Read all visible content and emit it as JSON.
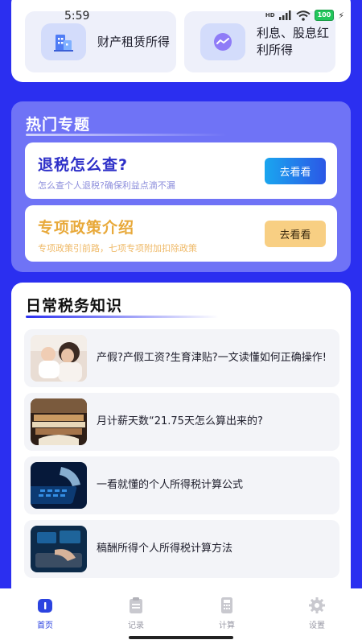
{
  "status_bar": {
    "time": "5:59",
    "battery": "100",
    "network": "HD"
  },
  "income_tiles": [
    {
      "label": "财产租赁所得",
      "icon": "building-icon"
    },
    {
      "label": "利息、股息红利所得",
      "icon": "chart-wave-icon"
    }
  ],
  "hot_topics": {
    "title": "热门专题",
    "items": [
      {
        "title": "退税怎么查?",
        "subtitle": "怎么查个人退税?确保利益点滴不漏",
        "button": "去看看",
        "color": "#2d2fc8"
      },
      {
        "title": "专项政策介绍",
        "subtitle": "专项政策引前路，七项专项附加扣除政策",
        "button": "去看看",
        "color": "#e8a93a"
      }
    ]
  },
  "daily_knowledge": {
    "title": "日常税务知识",
    "articles": [
      {
        "title": "产假?产假工资?生育津贴?一文读懂如何正确操作!",
        "thumb": "mother-baby-photo"
      },
      {
        "title": "月计薪天数“21.75天怎么算出来的?",
        "thumb": "books-photo"
      },
      {
        "title": "一看就懂的个人所得税计算公式",
        "thumb": "keyboard-hand-photo"
      },
      {
        "title": "稿酬所得个人所得税计算方法",
        "thumb": "laptop-data-photo"
      }
    ]
  },
  "bottom_nav": {
    "items": [
      {
        "label": "首页",
        "icon": "home-icon",
        "active": true
      },
      {
        "label": "记录",
        "icon": "clipboard-icon",
        "active": false
      },
      {
        "label": "计算",
        "icon": "calculator-icon",
        "active": false
      },
      {
        "label": "设置",
        "icon": "gear-icon",
        "active": false
      }
    ]
  },
  "colors": {
    "primary": "#2b2ff0",
    "panel": "#6f73f6",
    "accent_orange": "#e8a93a"
  }
}
